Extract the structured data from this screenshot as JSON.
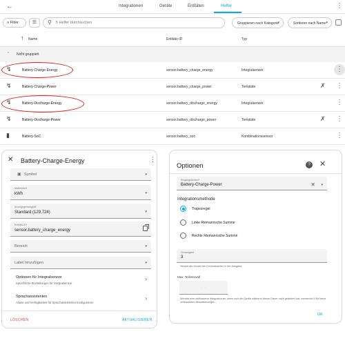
{
  "topbar": {
    "tabs": [
      "Integrationen",
      "Geräte",
      "Entitäten",
      "Helfer"
    ],
    "active_tab": "Helfer"
  },
  "filterbar": {
    "filter_label": "Filter",
    "search_placeholder": "5 Helfer durchsuchen",
    "group_select": "Gruppieren nach Kategorie",
    "sort_select": "Sortieren nach Name"
  },
  "table": {
    "columns": {
      "name": "Name",
      "entity_id": "Entitäts-ID",
      "type": "Typ"
    },
    "group_label": "Nicht gruppiert",
    "rows": [
      {
        "name": "Battery-Charge-Energy",
        "entity_id": "sensor.battery_charge_energy",
        "type": "Integralsensor",
        "icon": "lightning-icon",
        "highlighted": true
      },
      {
        "name": "Battery-Charge-Power",
        "entity_id": "sensor.battery_charge_power",
        "type": "Template",
        "icon": "lightning-icon",
        "highlighted": false
      },
      {
        "name": "Battery-Discharge-Energy",
        "entity_id": "sensor.battery_discharge_energy",
        "type": "Integralsensor",
        "icon": "lightning-icon",
        "highlighted": true
      },
      {
        "name": "Battery-Discharge-Power",
        "entity_id": "sensor.battery_discharge_power",
        "type": "Template",
        "icon": "lightning-icon",
        "highlighted": false
      },
      {
        "name": "Battery-SoC",
        "entity_id": "sensor.battery_soc",
        "type": "Kombinationssensor",
        "icon": "battery-icon",
        "highlighted": false
      }
    ]
  },
  "entity_dialog": {
    "title": "Battery-Charge-Energy",
    "icon_placeholder": "Symbol",
    "unit_label": "Maßeinheit",
    "unit_value": "kWh",
    "precision_label": "Anzeigegenauigkeit",
    "precision_value": "Standard (129,724)",
    "entity_id_label": "Entitäts-ID*",
    "entity_id_value": "sensor.battery_charge_energy",
    "area_placeholder": "Bereich",
    "label_placeholder": "Label hinzufügen",
    "options_title": "Optionen für Integralsensor",
    "options_sub": "Spezifische Einstellungen für Integralsensor",
    "voice_title": "Sprachassistenten",
    "voice_sub": "Aliase und Verfügbarkeit für Sprachassistenten konfigurieren",
    "delete_label": "LÖSCHEN",
    "update_label": "AKTUALISIEREN"
  },
  "options_dialog": {
    "title": "Optionen",
    "input_label": "Eingangssensor*",
    "input_value": "Battery-Charge-Power",
    "method_title": "Integrationsmethode",
    "methods": [
      "Trapezregel",
      "Linke Riemannsche Summe",
      "Rechte Riemannsche Summe"
    ],
    "selected_method": "Trapezregel",
    "precision_label": "Genauigkeit",
    "precision_value": "3",
    "precision_help": "Steuert die Anzahl der Dezimalstellen in der Ausgabe.",
    "time_window_label": "Max. Teilintervall",
    "time_window_help": "Wendet eine zeitbasierte Integration an, wenn sich die Quelle während dieser Dauer nicht geändert hat, verwendet 0 für keine zeitbasierten Aktualisierungen.",
    "ok_label": "OK"
  }
}
